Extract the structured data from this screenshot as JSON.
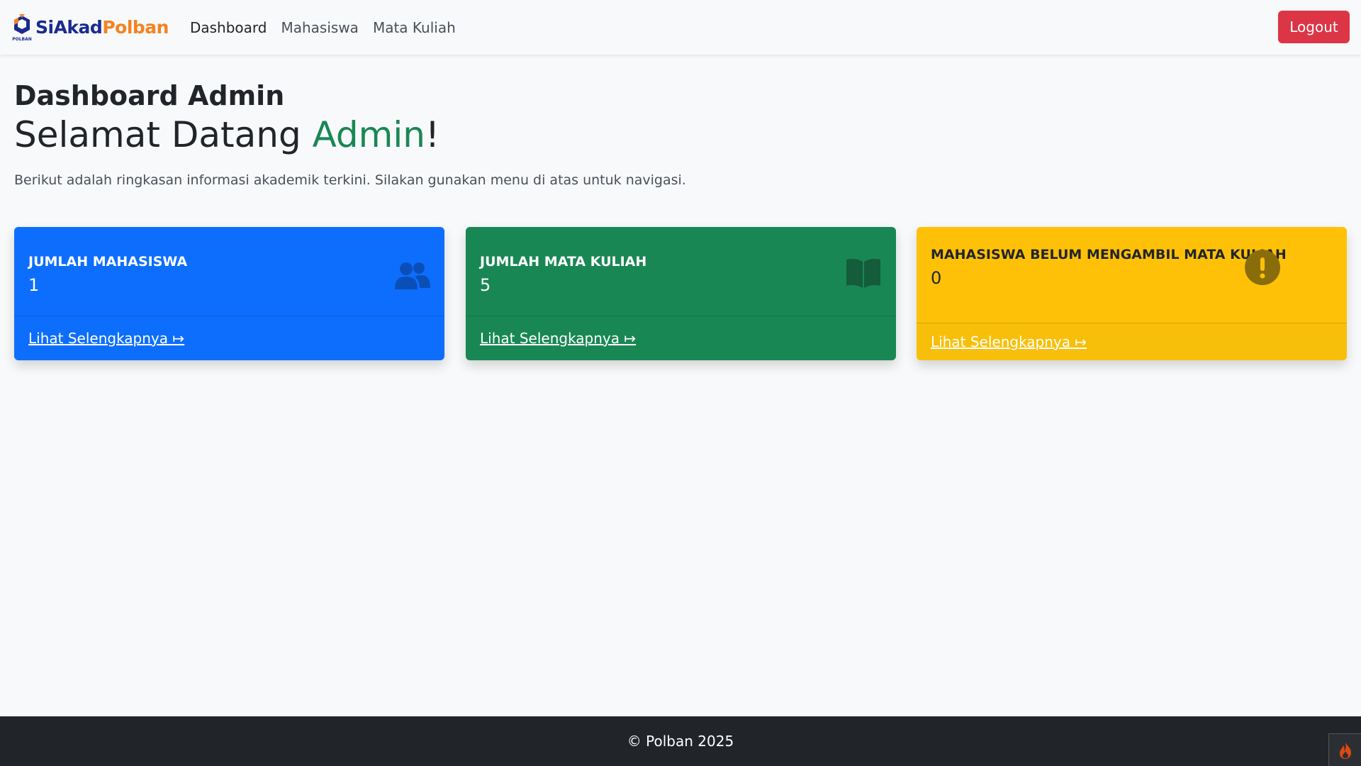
{
  "navbar": {
    "brand_si": "SiAkad",
    "brand_polban": "Polban",
    "logo_caption": "POLBAN",
    "links": [
      {
        "label": "Dashboard",
        "active": true
      },
      {
        "label": "Mahasiswa",
        "active": false
      },
      {
        "label": "Mata Kuliah",
        "active": false
      }
    ],
    "logout_label": "Logout"
  },
  "main": {
    "title": "Dashboard Admin",
    "welcome_prefix": "Selamat Datang ",
    "welcome_name": "Admin",
    "welcome_suffix": "!",
    "lead": "Berikut adalah ringkasan informasi akademik terkini. Silakan gunakan menu di atas untuk navigasi."
  },
  "cards": [
    {
      "label": "JUMLAH MAHASISWA",
      "value": "1",
      "link": "Lihat Selengkapnya ↦",
      "icon": "users-icon",
      "color": "#0d6efd"
    },
    {
      "label": "JUMLAH MATA KULIAH",
      "value": "5",
      "link": "Lihat Selengkapnya ↦",
      "icon": "book-icon",
      "color": "#198754"
    },
    {
      "label": "MAHASISWA BELUM MENGAMBIL MATA KULIAH",
      "value": "0",
      "link": "Lihat Selengkapnya ↦",
      "icon": "exclamation-circle-icon",
      "color": "#ffc107"
    }
  ],
  "footer": {
    "text": "© Polban 2025"
  },
  "colors": {
    "primary": "#0d6efd",
    "success": "#198754",
    "warning": "#ffc107",
    "danger": "#dc3545",
    "dark": "#212529"
  }
}
